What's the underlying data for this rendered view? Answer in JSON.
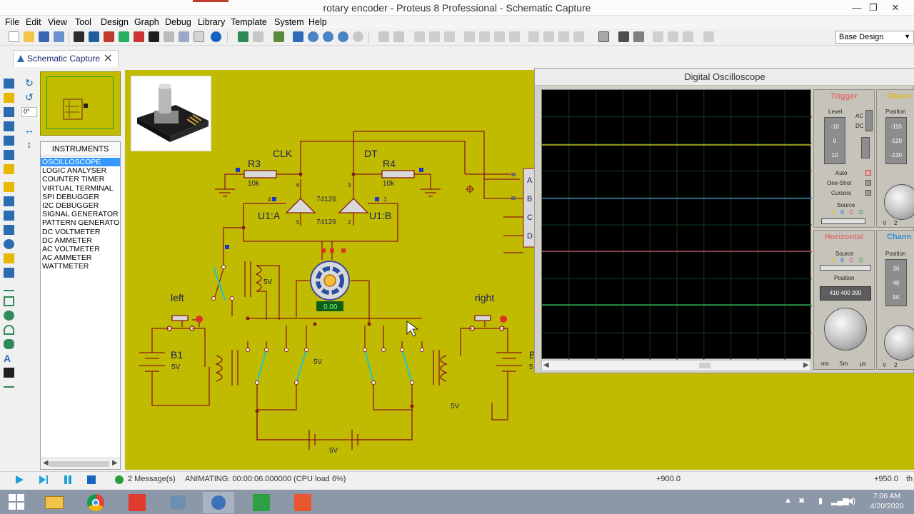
{
  "window": {
    "title": "rotary encoder - Proteus 8 Professional - Schematic Capture",
    "minimize": "—",
    "maximize": "❐",
    "close": "✕"
  },
  "menu": [
    "File",
    "Edit",
    "View",
    "Tool",
    "Design",
    "Graph",
    "Debug",
    "Library",
    "Template",
    "System",
    "Help"
  ],
  "toolbar": {
    "design_select": "Base Design"
  },
  "tab": {
    "label": "Schematic Capture",
    "close": "✕"
  },
  "rotation": {
    "value": "0°"
  },
  "instruments": {
    "header": "INSTRUMENTS",
    "items": [
      "OSCILLOSCOPE",
      "LOGIC ANALYSER",
      "COUNTER TIMER",
      "VIRTUAL TERMINAL",
      "SPI DEBUGGER",
      "I2C DEBUGGER",
      "SIGNAL GENERATOR",
      "PATTERN GENERATO",
      "DC VOLTMETER",
      "DC AMMETER",
      "AC VOLTMETER",
      "AC AMMETER",
      "WATTMETER"
    ],
    "selected": "OSCILLOSCOPE"
  },
  "schematic": {
    "labels": {
      "clk": "CLK",
      "dt": "DT",
      "r3": "R3",
      "r3_val": "10k",
      "r4": "R4",
      "r4_val": "10k",
      "u1a": "U1:A",
      "u1b": "U1:B",
      "opamp_top": "74126",
      "opamp_bottom": "74126",
      "pin4": "4",
      "pin6": "6",
      "pin3": "3",
      "pin1": "1",
      "pin5": "5",
      "pin2": "2",
      "left": "left",
      "right": "right",
      "b1": "B1",
      "b1_v": "5V",
      "coil_left_v": "5V",
      "bridge_v": "5V",
      "bottom_battery_v": "5V",
      "right_v": "5V",
      "motor_readout": "0.00",
      "osc_ch_a": "A",
      "osc_ch_b": "B",
      "osc_ch_c": "C",
      "osc_ch_d": "D",
      "cut_b": "B",
      "cut_5": "5"
    }
  },
  "oscilloscope": {
    "title": "Digital Oscilloscope",
    "trigger": {
      "header": "Trigger",
      "level": "Level",
      "ac": "AC",
      "dc": "DC",
      "auto": "Auto",
      "one_shot": "One-Shot",
      "cursors": "Cursors",
      "source": "Source",
      "level_ticks": [
        "-10",
        "0",
        "10"
      ],
      "src_letters": [
        "A",
        "B",
        "C",
        "D"
      ]
    },
    "channel_top": {
      "header": "Chann",
      "position": "Position",
      "ticks": [
        "-110",
        "-120",
        "-130"
      ],
      "unit": "V",
      "x": "2"
    },
    "horizontal": {
      "header": "Horizontal",
      "source": "Source",
      "position": "Position",
      "pos_display": "410  400  390",
      "units": [
        "ms",
        "5m",
        "μs"
      ],
      "src_letters": [
        "A",
        "B",
        "C",
        "D"
      ]
    },
    "channel_bottom": {
      "header": "Chann",
      "position": "Position",
      "ticks": [
        "30",
        "40",
        "50"
      ],
      "unit": "V",
      "x": "2"
    }
  },
  "status": {
    "messages": "2 Message(s)",
    "animating": "ANIMATING: 00:00:06.000000 (CPU load 6%)",
    "coord_x": "+900.0",
    "coord_y": "+950.0",
    "unit_cut": "th"
  },
  "taskbar": {
    "time": "7:06 AM",
    "date": "4/20/2020"
  }
}
